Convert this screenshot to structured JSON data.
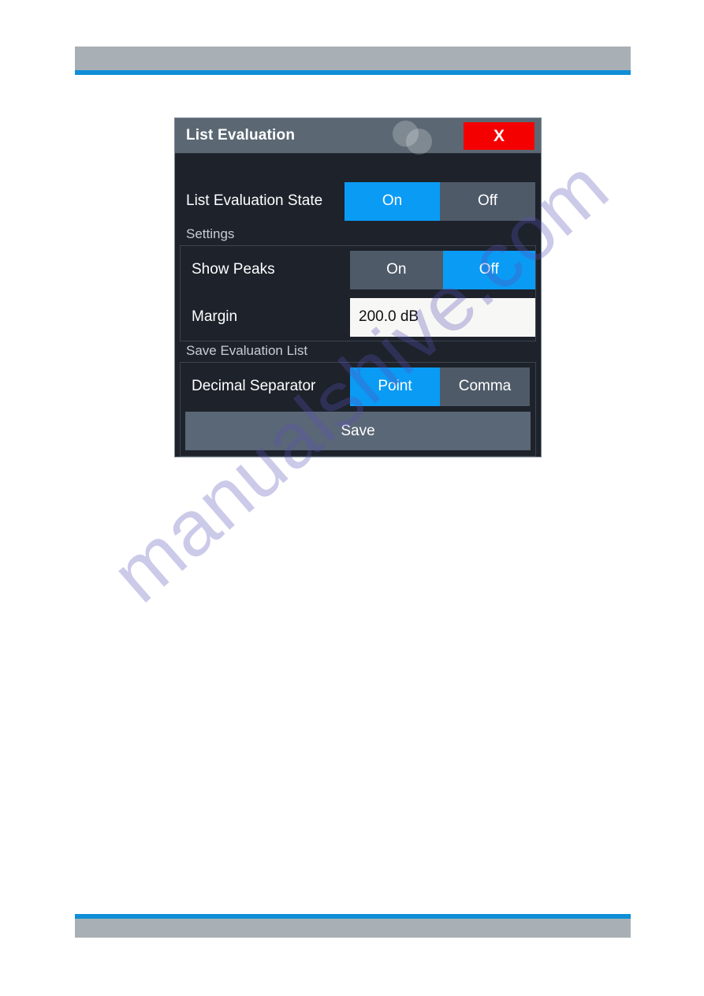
{
  "colors": {
    "accent_blue": "#0a9bf5",
    "close_red": "#f50000",
    "titlebar_gray": "#5b6874",
    "dialog_bg": "#1d222b",
    "control_gray": "#4e5a68",
    "rule_blue": "#0f8ed6",
    "banner_gray": "#a8b0b5",
    "input_bg": "#f7f7f5"
  },
  "watermark": {
    "text": "manualshive.com"
  },
  "dialog": {
    "title": "List Evaluation",
    "close_label": "X",
    "rows": {
      "list_evaluation_state": {
        "label": "List Evaluation State",
        "options": [
          "On",
          "Off"
        ],
        "selected": "On"
      },
      "show_peaks": {
        "label": "Show Peaks",
        "options": [
          "On",
          "Off"
        ],
        "selected": "Off"
      },
      "margin": {
        "label": "Margin",
        "value": "200.0 dB"
      },
      "decimal_separator": {
        "label": "Decimal Separator",
        "options": [
          "Point",
          "Comma"
        ],
        "selected": "Point"
      }
    },
    "sections": {
      "settings_caption": "Settings",
      "save_caption": "Save Evaluation List"
    },
    "save_button_label": "Save"
  }
}
